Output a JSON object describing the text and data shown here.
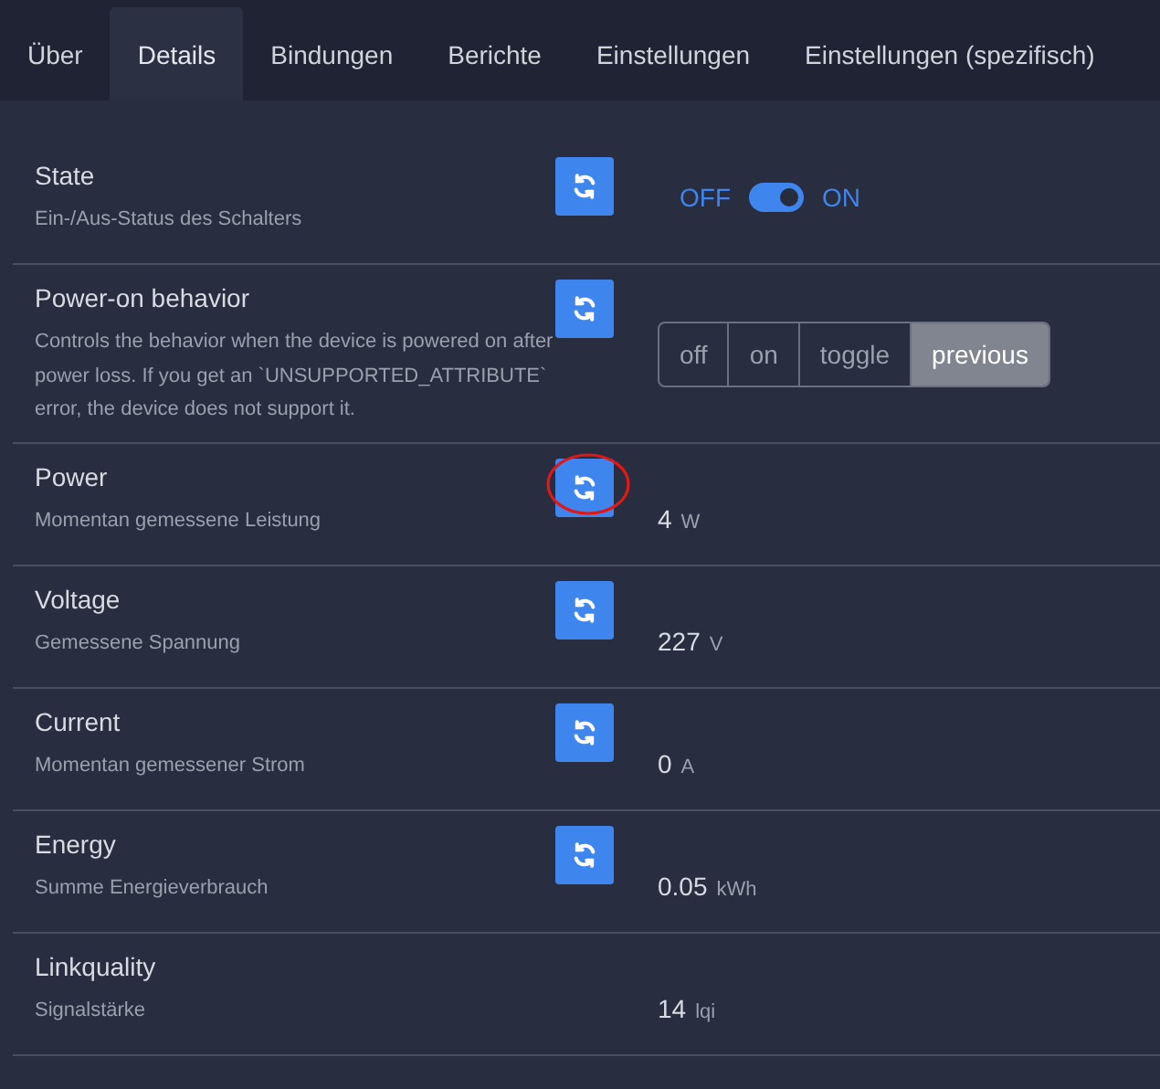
{
  "tabs": [
    {
      "label": "Über",
      "selected": false
    },
    {
      "label": "Details",
      "selected": true
    },
    {
      "label": "Bindungen",
      "selected": false
    },
    {
      "label": "Berichte",
      "selected": false
    },
    {
      "label": "Einstellungen",
      "selected": false
    },
    {
      "label": "Einstellungen (spezifisch)",
      "selected": false
    }
  ],
  "rows": [
    {
      "kind": "switch",
      "name": "State",
      "description": "Ein-/Aus-Status des Schalters",
      "refresh": true,
      "annotated": false,
      "off_label": "OFF",
      "on_label": "ON",
      "on": true
    },
    {
      "kind": "enum",
      "name": "Power-on behavior",
      "description": "Controls the behavior when the device is powered on after power loss. If you get an `UNSUPPORTED_ATTRIBUTE` error, the device does not support it.",
      "refresh": true,
      "annotated": false,
      "options": [
        {
          "label": "off",
          "selected": false
        },
        {
          "label": "on",
          "selected": false
        },
        {
          "label": "toggle",
          "selected": false
        },
        {
          "label": "previous",
          "selected": true
        }
      ]
    },
    {
      "kind": "numeric",
      "name": "Power",
      "description": "Momentan gemessene Leistung",
      "refresh": true,
      "annotated": true,
      "value": "4",
      "unit": "W"
    },
    {
      "kind": "numeric",
      "name": "Voltage",
      "description": "Gemessene Spannung",
      "refresh": true,
      "annotated": false,
      "value": "227",
      "unit": "V"
    },
    {
      "kind": "numeric",
      "name": "Current",
      "description": "Momentan gemessener Strom",
      "refresh": true,
      "annotated": false,
      "value": "0",
      "unit": "A"
    },
    {
      "kind": "numeric",
      "name": "Energy",
      "description": "Summe Energieverbrauch",
      "refresh": true,
      "annotated": false,
      "value": "0.05",
      "unit": "kWh"
    },
    {
      "kind": "numeric",
      "name": "Linkquality",
      "description": "Signalstärke",
      "refresh": false,
      "annotated": false,
      "value": "14",
      "unit": "lqi"
    }
  ]
}
